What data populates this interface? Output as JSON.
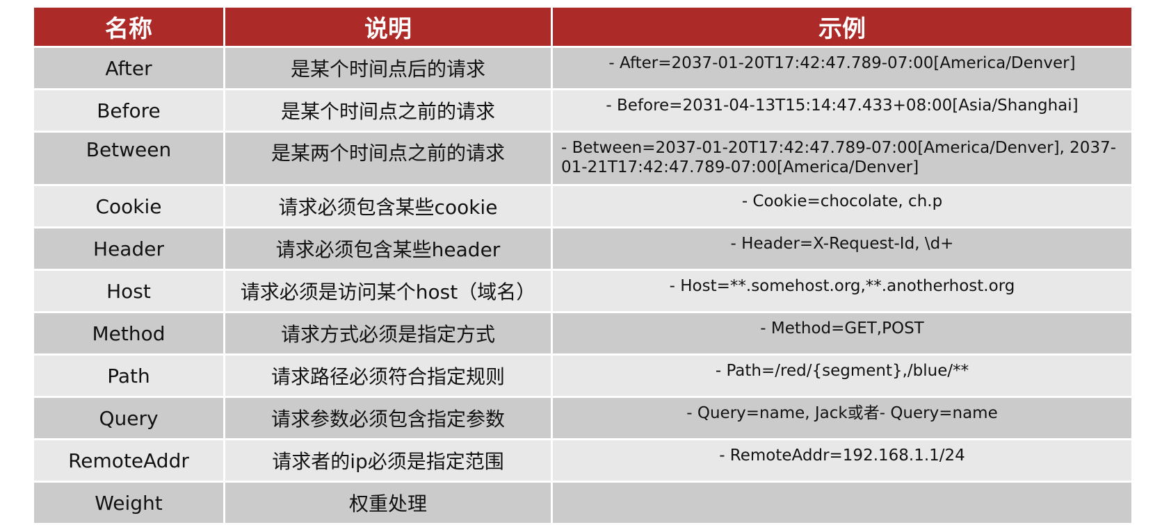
{
  "table": {
    "headers": [
      "名称",
      "说明",
      "示例"
    ],
    "rows": [
      {
        "name": "After",
        "desc": "是某个时间点后的请求",
        "example": "- After=2037-01-20T17:42:47.789-07:00[America/Denver]"
      },
      {
        "name": "Before",
        "desc": "是某个时间点之前的请求",
        "example": "- Before=2031-04-13T15:14:47.433+08:00[Asia/Shanghai]"
      },
      {
        "name": "Between",
        "desc": "是某两个时间点之前的请求",
        "example": "- Between=2037-01-20T17:42:47.789-07:00[America/Denver], 2037-01-21T17:42:47.789-07:00[America/Denver]"
      },
      {
        "name": "Cookie",
        "desc": "请求必须包含某些cookie",
        "example": "- Cookie=chocolate, ch.p"
      },
      {
        "name": "Header",
        "desc": "请求必须包含某些header",
        "example": "- Header=X-Request-Id, \\d+"
      },
      {
        "name": "Host",
        "desc": "请求必须是访问某个host（域名）",
        "example": "- Host=**.somehost.org,**.anotherhost.org"
      },
      {
        "name": "Method",
        "desc": "请求方式必须是指定方式",
        "example": "- Method=GET,POST"
      },
      {
        "name": "Path",
        "desc": "请求路径必须符合指定规则",
        "example": "- Path=/red/{segment},/blue/**"
      },
      {
        "name": "Query",
        "desc": "请求参数必须包含指定参数",
        "example": "- Query=name, Jack或者- Query=name"
      },
      {
        "name": "RemoteAddr",
        "desc": "请求者的ip必须是指定范围",
        "example": "- RemoteAddr=192.168.1.1/24"
      },
      {
        "name": "Weight",
        "desc": "权重处理",
        "example": ""
      }
    ]
  },
  "colors": {
    "header_bg": "#ac2a28",
    "row_dark": "#cbcbcb",
    "row_light": "#e8e8e8"
  }
}
